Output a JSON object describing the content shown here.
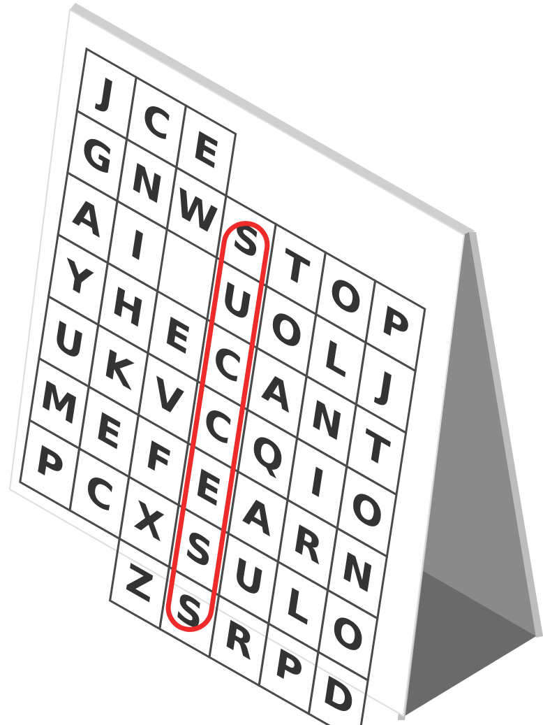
{
  "puzzle": {
    "grid": [
      [
        "J",
        "C",
        "E",
        "",
        "",
        "",
        ""
      ],
      [
        "G",
        "N",
        "W",
        "S",
        "T",
        "O",
        "P"
      ],
      [
        "A",
        "I",
        "",
        "U",
        "O",
        "L",
        "J"
      ],
      [
        "Y",
        "H",
        "E",
        "C",
        "A",
        "N",
        "T"
      ],
      [
        "U",
        "K",
        "V",
        "C",
        "Q",
        "I",
        "O"
      ],
      [
        "M",
        "E",
        "F",
        "E",
        "A",
        "R",
        "N"
      ],
      [
        "P",
        "C",
        "X",
        "S",
        "U",
        "L",
        "O"
      ],
      [
        "",
        "",
        "Z",
        "S",
        "R",
        "P",
        "D"
      ]
    ],
    "highlighted_word": "SUCCESS",
    "highlight_color": "#ee2a2a",
    "board_color": "#ffffff",
    "stand_color": "#888888"
  }
}
